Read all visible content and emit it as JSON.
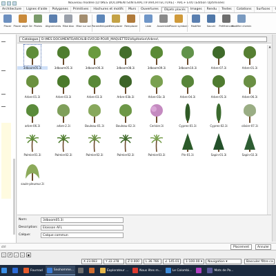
{
  "titlebar": {
    "title": "Nouveau modèle [D:\\MES DOCUMENTS\\INTERACTIF\\ARCHITECTURE] - ARC+ EVO (Edition Optimisée)"
  },
  "ribbon_tabs": [
    "Architecture",
    "Lignes d'aide",
    "Polygones",
    "Primitives",
    "Hachures et motifs",
    "Murs",
    "Ouvertures",
    "Objets placés",
    "Images",
    "Rendu",
    "Textes",
    "Cotations",
    "Surfaces",
    "Charpente"
  ],
  "active_tab_index": 7,
  "ribbon_buttons": [
    {
      "label": "Placer",
      "color": "#6c8fbf"
    },
    {
      "label": "Placer objet 3d",
      "color": "#c98a3a"
    },
    {
      "label": "Pilotes",
      "color": "#7a9a6a"
    },
    {
      "label": "Alignements",
      "color": "#5b7fae"
    },
    {
      "label": "Mise bloc",
      "color": "#9aa0aa"
    },
    {
      "label": "Mise sur sol",
      "color": "#a38d6e"
    },
    {
      "label": "Paramétriques",
      "color": "#5d86b8"
    },
    {
      "label": "Remplacer",
      "color": "#c4a245"
    },
    {
      "label": "Remplacer",
      "color": "#b07a3a"
    },
    {
      "label": "Liste",
      "color": "#6f96c8"
    },
    {
      "label": "Assembler",
      "color": "#8a8a8a"
    },
    {
      "label": "Placer symbole",
      "color": "#d09a3a"
    },
    {
      "label": "Modifier",
      "color": "#5a7fb0"
    },
    {
      "label": "Sauver",
      "color": "#4f77a8"
    },
    {
      "label": "Préférences",
      "color": "#6e6e6e"
    },
    {
      "label": "Modifier chemin",
      "color": "#7a9ac0"
    }
  ],
  "catalog": {
    "button_label": "Catalogue...",
    "path": "D:\\MES DOCUMENTS\\ARCALIB-EVO\\3D-POUR_MAQUETTES\\Végétation\\Arbres\\",
    "items": [
      {
        "name": "3dboom05.3i",
        "type": "tree",
        "color": "#5f8d3a",
        "selected": true
      },
      {
        "name": "3dboom05.3i",
        "type": "tree",
        "color": "#4f7d2f"
      },
      {
        "name": "3dboom06.3i",
        "type": "tree",
        "color": "#6a9a3f"
      },
      {
        "name": "3dboom08.3i",
        "type": "tree",
        "color": "#446e2c"
      },
      {
        "name": "3dboom09.3i",
        "type": "tree",
        "color": "#5a8a36"
      },
      {
        "name": "3dboom10.3i",
        "type": "tree",
        "color": "#61924a"
      },
      {
        "name": "Arbre-07.3i",
        "type": "tree",
        "color": "#3f6a2a"
      },
      {
        "name": "Arbre-01.3i",
        "type": "tree",
        "color": "#567f33"
      },
      {
        "name": "Arbre-01.3i",
        "type": "tree",
        "color": "#6b9140"
      },
      {
        "name": "Arbre-03.3i",
        "type": "tree",
        "color": "#4b7a2c"
      },
      {
        "name": "Arbre-03.3i",
        "type": "tree",
        "color": "#5a8838"
      },
      {
        "name": "Arbre-03b.3i",
        "type": "tree",
        "color": "#3d6428"
      },
      {
        "name": "Arbre-03c.3i",
        "type": "tree",
        "color": "#7aa050"
      },
      {
        "name": "Arbre-04.3i",
        "type": "tree",
        "color": "#58853a"
      },
      {
        "name": "Arbre-05.3i",
        "type": "tree",
        "color": "#4f7b30"
      },
      {
        "name": "Arbre-06.3i",
        "type": "tree",
        "color": "#6a8f44"
      },
      {
        "name": "arbre-06.3i",
        "type": "tree",
        "color": "#5b8b3b"
      },
      {
        "name": "arbre-2.3i",
        "type": "tree",
        "color": "#7f9f5a"
      },
      {
        "name": "Bouleau-01.3i",
        "type": "tree",
        "color": "#88a85c"
      },
      {
        "name": "Bouleau-02.3i",
        "type": "tree",
        "color": "#6d9747"
      },
      {
        "name": "Cerisier.3i",
        "type": "flower",
        "color": "#c48ac0"
      },
      {
        "name": "Cypres-01.3i",
        "type": "cypress",
        "color": "#2f5a26"
      },
      {
        "name": "Cypres-02.3i",
        "type": "cypress",
        "color": "#3b6a2e"
      },
      {
        "name": "olivier-07.3i",
        "type": "tree",
        "color": "#9aad84"
      },
      {
        "name": "Palmier01.3i",
        "type": "palm",
        "color": "#5f8d3a"
      },
      {
        "name": "Palmier02.3i",
        "type": "palm",
        "color": "#4f7d2f"
      },
      {
        "name": "Palmier02.3i",
        "type": "palm",
        "color": "#6a8f44"
      },
      {
        "name": "Palmier02.3i",
        "type": "palm",
        "color": "#3f6a2a"
      },
      {
        "name": "Palmier03.3i",
        "type": "palm",
        "color": "#7aa050"
      },
      {
        "name": "Pin-01.3i",
        "type": "conifer",
        "color": "#2c5a2a"
      },
      {
        "name": "Sapin-01.3i",
        "type": "conifer",
        "color": "#24502a"
      },
      {
        "name": "Sapin-02.3i",
        "type": "conifer",
        "color": "#2e5d33"
      },
      {
        "name": "saule-pleureur.3i",
        "type": "willow",
        "color": "#8caa5a"
      }
    ]
  },
  "properties": {
    "name_label": "Nom:",
    "name_value": "3dboom05.3i",
    "desc_label": "Description:",
    "desc_value": "Eloisson AFL",
    "layer_label": "Calque:",
    "layer_value": "Calque commun"
  },
  "cmdbar": {
    "label": "ctrl",
    "place_label": "Placement",
    "annuler_label": "Annuler"
  },
  "status": {
    "x": "23.083",
    "y": "22.378",
    "z": "0.000",
    "len": "36.766",
    "angle": "145.01",
    "scale": "1:100.00",
    "mode": "Navigation",
    "filter": "Basculer filtre ca"
  },
  "taskbar": [
    {
      "label": "",
      "color": "#2b6ad6"
    },
    {
      "label": "Fournad",
      "color": "#e55a2b"
    },
    {
      "label": "Snohomme...",
      "color": "#3a7bd5"
    },
    {
      "label": "",
      "color": "#6c6c6c"
    },
    {
      "label": "",
      "color": "#cf6c2e"
    },
    {
      "label": "Explorateur ...",
      "color": "#e8b84a"
    },
    {
      "label": "Nous êtes m...",
      "color": "#de3b2f"
    },
    {
      "label": "Le Colombi...",
      "color": "#3c8ad9"
    },
    {
      "label": "",
      "color": "#b040c0"
    },
    {
      "label": "Mots de Pa...",
      "color": "#5a5a9a"
    }
  ]
}
